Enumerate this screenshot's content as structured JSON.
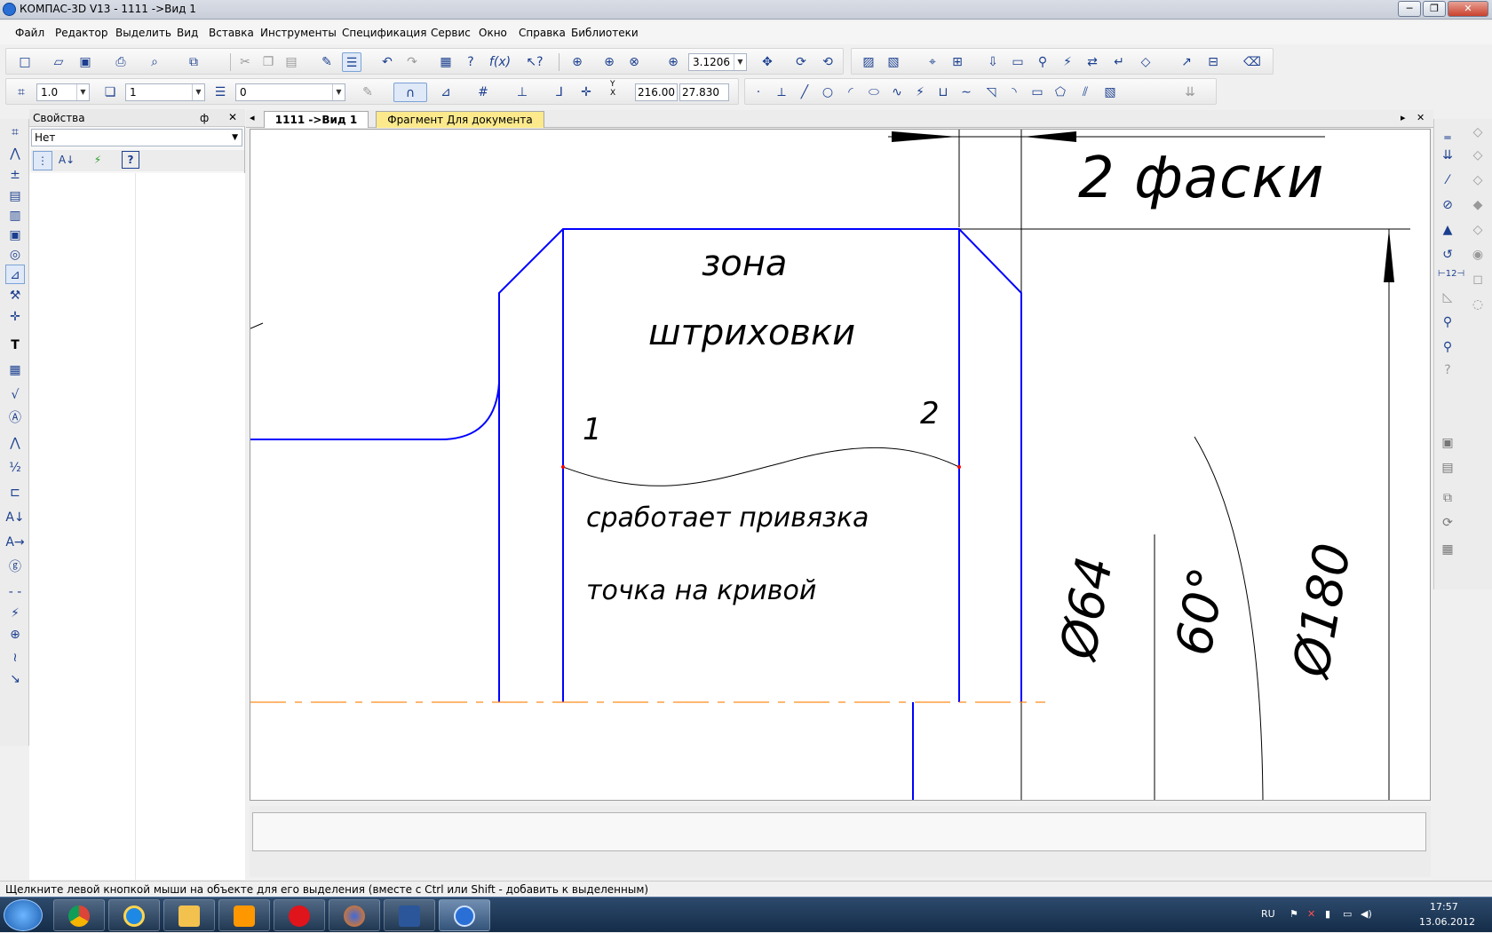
{
  "window": {
    "title": "КОМПАС-3D V13 - 1111 ->Вид 1",
    "minimize_icon": "minimize-icon",
    "restore_icon": "restore-icon",
    "close_icon": "close-icon"
  },
  "menu": [
    "Файл",
    "Редактор",
    "Выделить",
    "Вид",
    "Вставка",
    "Инструменты",
    "Спецификация",
    "Сервис",
    "Окно",
    "Справка",
    "Библиотеки"
  ],
  "toolbar_standard": {
    "zoom_value": "3.1206"
  },
  "toolbar_current_state": {
    "step": "1.0",
    "view": "1",
    "layer": "0",
    "coord_x": "216.00",
    "coord_y": "27.830",
    "coord_axis_label": "Y X"
  },
  "properties_panel": {
    "title": "Свойства",
    "pin_label": "ф",
    "close_label": "✕",
    "selector_value": "Нет",
    "help_label": "?"
  },
  "tabs": [
    {
      "label": "1111 ->Вид 1",
      "active": true
    },
    {
      "label": "Фрагмент Для документа",
      "active": false
    }
  ],
  "tab_nav": {
    "left": "◂",
    "right": "▸",
    "close": "✕"
  },
  "drawing": {
    "dimension_note": "2 фаски",
    "zone_line1": "зона",
    "zone_line2": "штриховки",
    "point1": "1",
    "point2": "2",
    "snap_line1": "сработает привязка",
    "snap_line2": "точка на кривой",
    "dim_d64": "Ø64",
    "dim_angle": "60°",
    "dim_d180": "Ø180",
    "colors": {
      "contour": "#0000ff",
      "axis": "#ff8c1a",
      "thin": "#000000",
      "snap_points": "#ff0000"
    }
  },
  "status": "Щелкните левой кнопкой мыши на объекте для его выделения (вместе с Ctrl или Shift - добавить к выделенным)",
  "taskbar": {
    "apps": [
      "start-orb",
      "chrome",
      "internet-explorer",
      "explorer",
      "media-player",
      "opera",
      "firefox",
      "word",
      "kompas"
    ],
    "lang": "RU",
    "time": "17:57",
    "date": "13.06.2012"
  }
}
